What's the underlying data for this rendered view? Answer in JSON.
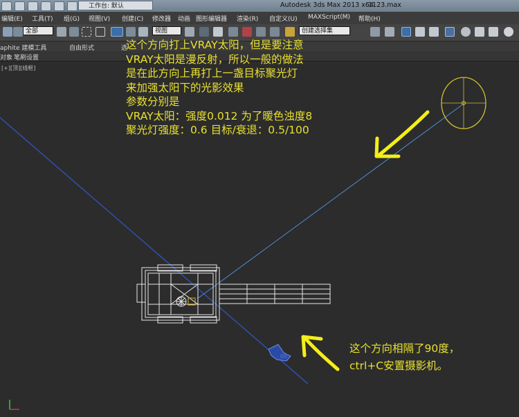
{
  "titlebar": {
    "workspace_label": "工作台: 默认",
    "app_title": "Autodesk 3ds Max  2013 x64",
    "file_name": "1123.max"
  },
  "menu": {
    "items": [
      "编辑(E)",
      "工具(T)",
      "组(G)",
      "视图(V)",
      "创建(C)",
      "修改器",
      "动画",
      "图形编辑器",
      "渲染(R)",
      "自定义(U)",
      "MAXScript(M)",
      "帮助(H)"
    ]
  },
  "toolbar": {
    "selection_filter": "全部",
    "reference_coord": "视图",
    "named_selection": "创建选择集"
  },
  "ribbon": {
    "tabs": [
      "aphite 建模工具",
      "自由形式",
      "选"
    ]
  },
  "subribbon": {
    "items": [
      "对象",
      "笔刷设置"
    ]
  },
  "viewport": {
    "label": "[+][顶][线框]"
  },
  "annotations": {
    "top_lines": [
      "这个方向打上VRAY太阳，但是要注意",
      "VRAY太阳是漫反射，所以一般的做法",
      "是在此方向上再打上一盏目标聚光灯",
      "来加强太阳下的光影效果",
      "参数分别是",
      "VRAY太阳：强度0.012 为了暖色浊度8",
      "聚光灯强度：0.6 目标/衰退：0.5/100"
    ],
    "bottom_lines": [
      "这个方向相隔了90度，",
      "ctrl+C安置摄影机。"
    ]
  },
  "colors": {
    "annotation_yellow": "#e8e030",
    "light_ring": "#d4c42a",
    "light_line": "#4f8fd6",
    "camera_line": "#2f4fa8",
    "viewport_bg": "#2c2c2c",
    "wireframe": "#e8e8e8"
  }
}
